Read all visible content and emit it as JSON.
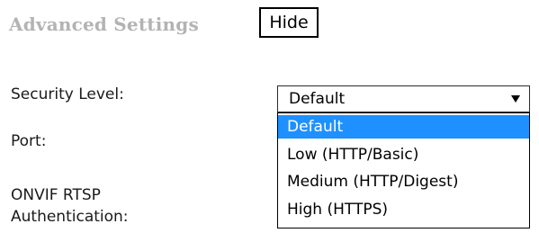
{
  "section": {
    "title": "Advanced Settings",
    "hide_label": "Hide"
  },
  "labels": {
    "security_level": "Security Level:",
    "port": "Port:",
    "onvif_line1": "ONVIF RTSP",
    "onvif_line2": "Authentication:"
  },
  "security_select": {
    "selected_value": "Default",
    "arrow_icon": "triangle-down-icon",
    "options": [
      {
        "label": "Default",
        "highlighted": true
      },
      {
        "label": "Low (HTTP/Basic)",
        "highlighted": false
      },
      {
        "label": "Medium (HTTP/Digest)",
        "highlighted": false
      },
      {
        "label": "High (HTTPS)",
        "highlighted": false
      }
    ]
  },
  "colors": {
    "title": "#b3b3b3",
    "highlight": "#1e90ff",
    "highlight_text": "#ffffff"
  }
}
